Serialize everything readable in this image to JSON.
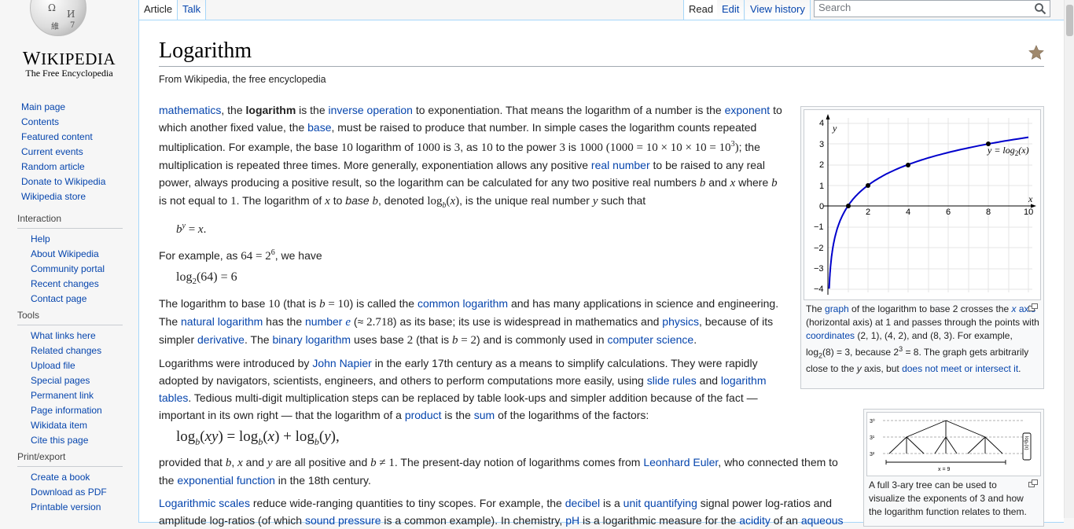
{
  "logo": {
    "wordmark": "Wikipedia",
    "tagline": "The Free Encyclopedia"
  },
  "sidebar": {
    "navigation": [
      {
        "label": "Main page"
      },
      {
        "label": "Contents"
      },
      {
        "label": "Featured content"
      },
      {
        "label": "Current events"
      },
      {
        "label": "Random article"
      },
      {
        "label": "Donate to Wikipedia"
      },
      {
        "label": "Wikipedia store"
      }
    ],
    "interaction": {
      "heading": "Interaction",
      "items": [
        {
          "label": "Help"
        },
        {
          "label": "About Wikipedia"
        },
        {
          "label": "Community portal"
        },
        {
          "label": "Recent changes"
        },
        {
          "label": "Contact page"
        }
      ]
    },
    "tools": {
      "heading": "Tools",
      "items": [
        {
          "label": "What links here"
        },
        {
          "label": "Related changes"
        },
        {
          "label": "Upload file"
        },
        {
          "label": "Special pages"
        },
        {
          "label": "Permanent link"
        },
        {
          "label": "Page information"
        },
        {
          "label": "Wikidata item"
        },
        {
          "label": "Cite this page"
        }
      ]
    },
    "print": {
      "heading": "Print/export",
      "items": [
        {
          "label": "Create a book"
        },
        {
          "label": "Download as PDF"
        },
        {
          "label": "Printable version"
        }
      ]
    }
  },
  "tabs": {
    "article": "Article",
    "talk": "Talk",
    "read": "Read",
    "edit": "Edit",
    "history": "View history"
  },
  "search": {
    "placeholder": "Search"
  },
  "article": {
    "title": "Logarithm",
    "site_sub": "From Wikipedia, the free encyclopedia"
  },
  "thumb1": {
    "caption_parts": [
      "The ",
      "graph",
      " of the logarithm to base 2 crosses the ",
      "x",
      " ",
      "axis",
      " (horizontal axis) at 1 and passes through the points with ",
      "coordinates",
      " (2, 1), (4, 2), and (8, 3). For example, log",
      "2",
      "(8) = 3, because 2",
      "3",
      " = 8. The graph gets arbitrarily close to the ",
      "y",
      " axis, but ",
      "does not meet or intersect it",
      "."
    ],
    "graph_label_y": "y",
    "graph_label_x": "x",
    "graph_curve_label": "y = log",
    "graph_curve_sub": "2",
    "graph_curve_arg": "(x)",
    "x_ticks": [
      "2",
      "4",
      "6",
      "8",
      "10"
    ],
    "y_ticks": [
      "4",
      "3",
      "2",
      "1",
      "0",
      "−1",
      "−2",
      "−3",
      "−4"
    ]
  },
  "thumb2": {
    "caption": "A full 3-ary tree can be used to visualize the exponents of 3 and how the logarithm function relates to them.",
    "labels": [
      "3⁰",
      "3¹",
      "3²",
      "x = 9",
      "log₃(x)"
    ]
  },
  "colors": {
    "link": "#0645ad",
    "curve": "#0000cc",
    "tab_border": "#a7d7f9"
  }
}
